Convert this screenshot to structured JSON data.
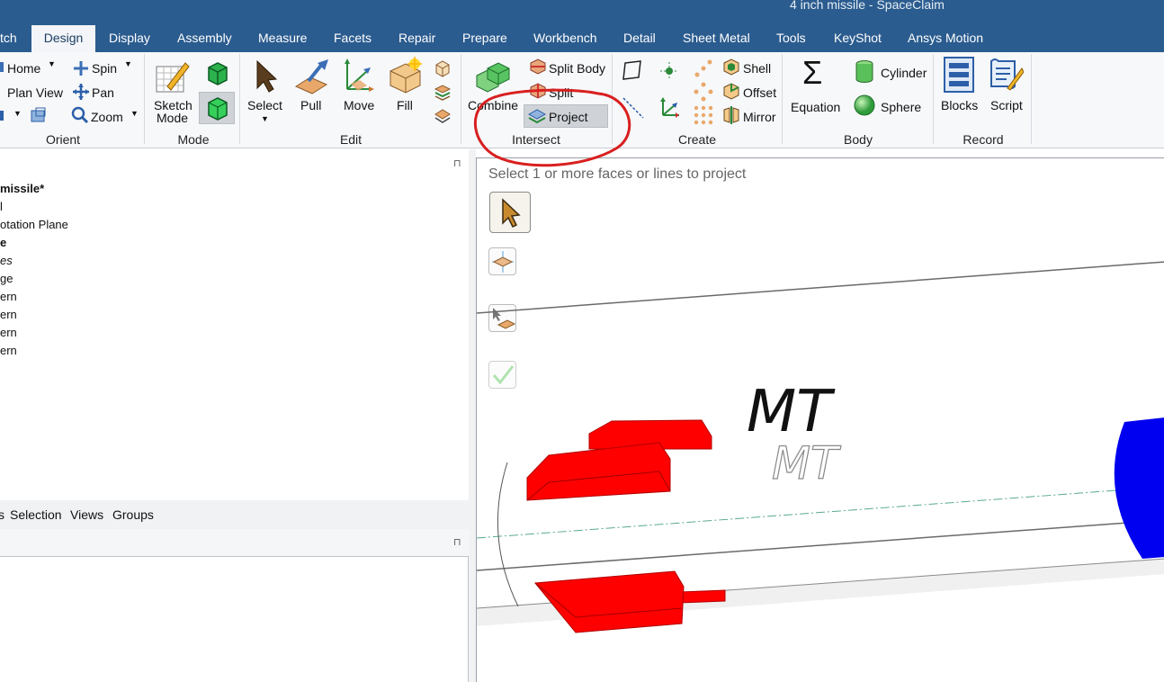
{
  "window": {
    "title": "4 inch missile - SpaceClaim"
  },
  "tabs": [
    {
      "label": "tch"
    },
    {
      "label": "Design"
    },
    {
      "label": "Display"
    },
    {
      "label": "Assembly"
    },
    {
      "label": "Measure"
    },
    {
      "label": "Facets"
    },
    {
      "label": "Repair"
    },
    {
      "label": "Prepare"
    },
    {
      "label": "Workbench"
    },
    {
      "label": "Detail"
    },
    {
      "label": "Sheet Metal"
    },
    {
      "label": "Tools"
    },
    {
      "label": "KeyShot"
    },
    {
      "label": "Ansys Motion"
    }
  ],
  "ribbon": {
    "orient": {
      "home": "Home",
      "spin": "Spin",
      "plan_view": "Plan View",
      "pan": "Pan",
      "zoom": "Zoom",
      "group": "Orient"
    },
    "mode": {
      "sketch": "Sketch",
      "sketch2": "Mode",
      "group": "Mode"
    },
    "edit": {
      "select": "Select",
      "pull": "Pull",
      "move": "Move",
      "fill": "Fill",
      "group": "Edit"
    },
    "intersect": {
      "combine": "Combine",
      "split_body": "Split Body",
      "split": "Split",
      "project": "Project",
      "group": "Intersect"
    },
    "create": {
      "shell": "Shell",
      "offset": "Offset",
      "mirror": "Mirror",
      "group": "Create"
    },
    "body": {
      "equation": "Equation",
      "cylinder": "Cylinder",
      "sphere": "Sphere",
      "group": "Body"
    },
    "record": {
      "blocks": "Blocks",
      "script": "Script",
      "group": "Record"
    }
  },
  "tree": {
    "items": [
      "missile*",
      "l",
      "otation Plane",
      "e",
      "es",
      "ge",
      "ern",
      "ern",
      "ern",
      "ern"
    ]
  },
  "panel_tabs": [
    "s",
    "Selection",
    "Views",
    "Groups"
  ],
  "viewport": {
    "prompt": "Select 1 or more faces or lines to project",
    "text_drawn": "MT",
    "text_projected": "MT"
  },
  "colors": {
    "title_bar": "#2b5c8f",
    "fins": "#ff0000",
    "nose": "#0000ff",
    "annotation": "#d91f1f"
  }
}
